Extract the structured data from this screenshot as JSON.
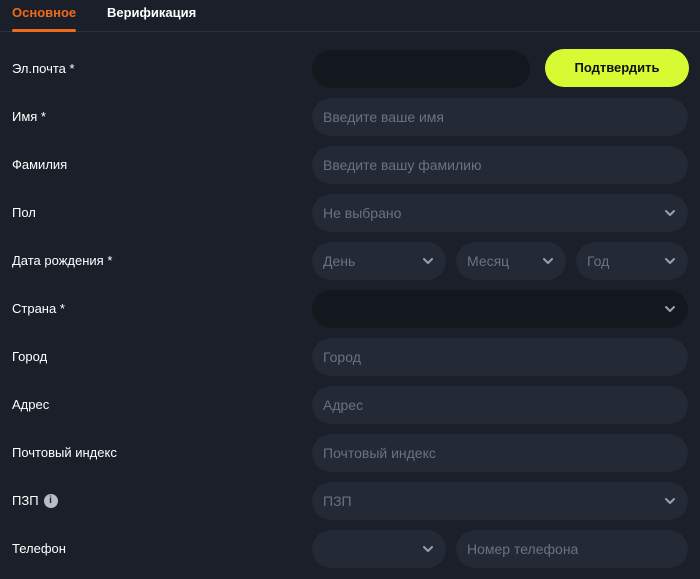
{
  "tabs": {
    "main": "Основное",
    "verification": "Верификация"
  },
  "form": {
    "email": {
      "label": "Эл.почта *",
      "value": "",
      "confirm_button": "Подтвердить"
    },
    "first_name": {
      "label": "Имя *",
      "placeholder": "Введите ваше имя"
    },
    "last_name": {
      "label": "Фамилия",
      "placeholder": "Введите вашу фамилию"
    },
    "gender": {
      "label": "Пол",
      "value": "Не выбрано"
    },
    "birth_date": {
      "label": "Дата рождения *",
      "day": "День",
      "month": "Месяц",
      "year": "Год"
    },
    "country": {
      "label": "Страна *",
      "value": ""
    },
    "city": {
      "label": "Город",
      "placeholder": "Город"
    },
    "address": {
      "label": "Адрес",
      "placeholder": "Адрес"
    },
    "postal_code": {
      "label": "Почтовый индекс",
      "placeholder": "Почтовый индекс"
    },
    "pzp": {
      "label": "ПЗП",
      "info_icon": "i",
      "value": "ПЗП"
    },
    "phone": {
      "label": "Телефон",
      "code": "",
      "placeholder": "Номер телефона"
    }
  },
  "colors": {
    "background": "#1a1f29",
    "field": "#232935",
    "accent": "#ef6a1b",
    "button": "#d7fb32"
  }
}
